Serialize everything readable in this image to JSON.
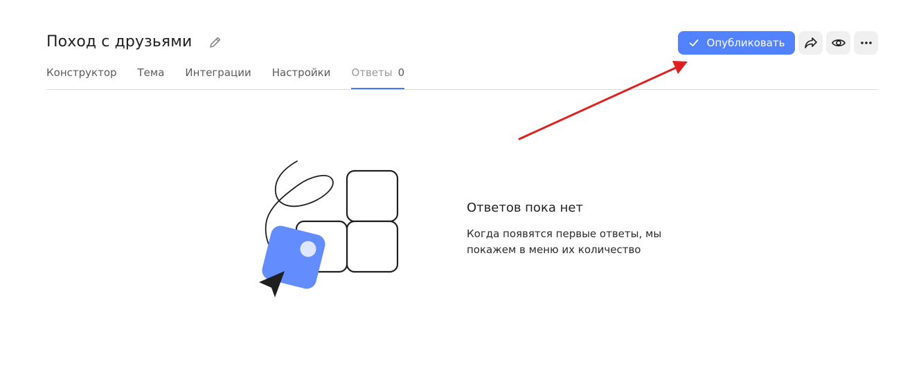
{
  "header": {
    "title": "Поход с друзьями",
    "edit_icon": "pencil-icon"
  },
  "tabs": [
    {
      "label": "Конструктор",
      "active": false
    },
    {
      "label": "Тема",
      "active": false
    },
    {
      "label": "Интеграции",
      "active": false
    },
    {
      "label": "Настройки",
      "active": false
    },
    {
      "label": "Ответы",
      "count": "0",
      "active": true
    }
  ],
  "toolbar": {
    "publish_label": "Опубликовать",
    "publish_icon": "check-icon",
    "share_icon": "share-arrow-icon",
    "preview_icon": "eye-icon",
    "more_icon": "more-dots-icon"
  },
  "empty_state": {
    "title": "Ответов пока нет",
    "description": "Когда появятся первые ответы, мы покажем в меню их количество"
  },
  "colors": {
    "accent": "#5282ff",
    "tab_underline": "#4a79ee",
    "annotation_arrow": "#e02020"
  }
}
